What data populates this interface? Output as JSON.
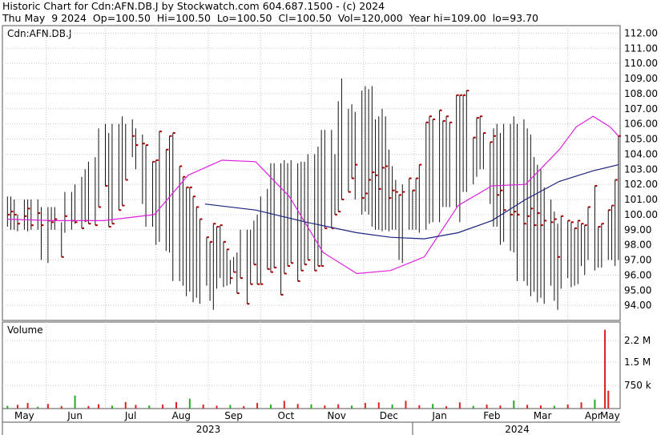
{
  "header": {
    "line1": "Historic Chart for Cdn:AFN.DB.J by Stockwatch.com 604.687.1500 - (c) 2024",
    "line2": "Thu May  9 2024  Op=100.50  Hi=100.50  Lo=100.50  Cl=100.50  Vol=120,000  Year hi=109.00  lo=93.70"
  },
  "chart_data": [
    {
      "type": "ohlc",
      "title": "Cdn:AFN.DB.J",
      "ylim": [
        93.0,
        112.5
      ],
      "yticks": [
        "112.00",
        "111.00",
        "110.00",
        "109.00",
        "108.00",
        "107.00",
        "106.00",
        "105.00",
        "104.00",
        "103.00",
        "102.00",
        "101.00",
        "100.00",
        "99.00",
        "98.00",
        "97.00",
        "96.00",
        "95.00",
        "94.00"
      ],
      "month_labels": [
        "May",
        "Jun",
        "Jul",
        "Aug",
        "Sep",
        "Oct",
        "Nov",
        "Dec",
        "Jan",
        "Feb",
        "Mar",
        "Apr",
        "May"
      ],
      "year_labels": [
        "2023",
        "2024"
      ],
      "colors": {
        "bar": "#aa0000",
        "ma_short": "#dd22dd",
        "ma_long": "#1a237e",
        "grid": "#c8c8c8"
      },
      "series": [
        {
          "days": [
            3,
            5,
            7,
            9,
            13,
            15,
            17,
            21,
            23,
            27,
            29,
            31,
            35,
            37,
            41,
            43,
            47,
            49,
            51,
            55,
            57,
            61,
            63,
            65,
            69,
            71,
            73,
            77,
            79,
            83,
            85,
            89,
            91,
            93,
            97,
            99,
            101,
            105,
            107,
            109,
            111,
            113,
            115,
            117,
            121,
            123,
            125,
            127,
            129,
            131,
            133,
            135,
            137,
            139,
            141,
            145,
            147,
            149,
            151,
            153,
            157,
            159,
            161,
            165,
            167,
            169,
            171,
            175,
            177,
            179,
            181,
            185,
            187,
            189,
            191,
            195,
            197,
            199,
            201,
            205,
            207,
            209,
            213,
            215,
            217,
            219,
            221,
            223,
            225,
            227,
            229,
            231,
            233,
            235,
            237,
            241,
            243,
            245,
            247,
            251,
            253,
            255,
            259,
            261,
            263,
            265,
            269,
            271,
            273,
            275,
            279,
            281,
            283,
            285,
            289,
            291,
            293,
            295,
            297,
            301,
            303,
            305,
            309,
            311,
            313,
            315,
            317,
            319,
            321,
            325,
            327,
            329,
            331,
            335,
            337,
            339,
            341,
            343,
            345,
            347,
            351,
            353,
            355,
            359,
            361,
            363,
            365
          ],
          "o": [
            100.0,
            100.2,
            100.0,
            99.4,
            99.9,
            100.4,
            99.3,
            100.1,
            99.3,
            99.6,
            99.5,
            99.7,
            97.2,
            99.9,
            99.6,
            99.5,
            99.1,
            99.6,
            99.4,
            99.3,
            100.5,
            101.9,
            99.2,
            99.4,
            100.3,
            100.6,
            102.3,
            105.2,
            104.6,
            104.7,
            104.6,
            103.5,
            103.6,
            105.5,
            104.3,
            105.2,
            105.4,
            103.2,
            102.5,
            101.8,
            101.8,
            101.2,
            100.5,
            99.7,
            98.5,
            98.2,
            99.4,
            99.2,
            99.3,
            98.2,
            97.7,
            95.8,
            96.2,
            94.8,
            95.8,
            94.1,
            95.4,
            96.7,
            95.4,
            95.4,
            96.4,
            96.2,
            96.5,
            94.7,
            96.1,
            96.6,
            96.8,
            95.6,
            96.3,
            96.7,
            97.0,
            96.3,
            96.6,
            96.6,
            99.1,
            99.1,
            100.0,
            100.2,
            101.0,
            101.5,
            102.4,
            103.3,
            101.1,
            101.4,
            102.3,
            102.8,
            102.6,
            101.7,
            103.1,
            103.2,
            101.1,
            101.6,
            101.5,
            101.3,
            101.5,
            102.4,
            101.6,
            102.4,
            103.3,
            106.1,
            106.5,
            106.3,
            106.9,
            106.2,
            106.5,
            106.1,
            107.9,
            107.9,
            107.9,
            108.2,
            105.1,
            106.4,
            106.5,
            105.4,
            104.8,
            105.2,
            101.3,
            101.6,
            100.3
          ],
          "h": [
            101.2,
            101.2,
            101.0,
            100.0,
            101.0,
            101.0,
            101.0,
            101.0,
            100.5,
            100.5,
            100.5,
            100.5,
            99.5,
            101.5,
            101.5,
            102.0,
            102.5,
            103.0,
            103.5,
            103.8,
            105.7,
            106.0,
            105.4,
            106.0,
            106.0,
            106.5,
            106.0,
            106.3,
            105.7,
            105.3,
            103.8,
            103.3,
            103.0,
            101.8,
            101.0,
            100.2,
            99.4,
            99.4,
            99.4,
            99.3,
            98.7,
            97.5,
            96.6,
            96.0,
            97.0,
            96.3,
            96.5,
            96.5,
            97.0,
            97.0,
            96.6,
            97.0,
            97.2,
            96.6,
            99.0,
            97.0,
            97.2,
            99.6,
            100.0,
            101.2,
            101.7,
            103.4,
            103.4,
            103.4,
            103.6,
            103.4,
            103.6,
            103.4,
            103.5,
            103.5,
            103.6,
            103.2,
            103.2,
            103.5,
            103.4,
            102.5,
            104.0,
            107.5,
            109.0,
            107.0,
            107.3,
            106.8,
            108.2,
            108.5,
            108.3,
            108.5,
            106.3,
            106.5,
            107.0,
            106.5,
            104.3,
            103.2,
            102.3,
            101.0,
            102.0
          ],
          "l": [
            99.2,
            99.0,
            99.0,
            98.9,
            99.0,
            98.9,
            99.0,
            99.0,
            97.0,
            96.8,
            99.0,
            99.0,
            99.0,
            98.8,
            99.0,
            99.4,
            99.5,
            99.5,
            101.5,
            101.5,
            103.3,
            104.0,
            104.2,
            102.5,
            103.0,
            103.5,
            104.5,
            103.8,
            103.0,
            100.7,
            99.2,
            99.2,
            98.0,
            98.2,
            97.6,
            97.5,
            95.6,
            95.6,
            95.3,
            94.6,
            94.9,
            94.2,
            94.5,
            94.1,
            95.3,
            94.3,
            93.7,
            95.1,
            95.8,
            95.2,
            95.3,
            95.4,
            96.6,
            97.5,
            98.9,
            99.0,
            99.0,
            99.3,
            100.0,
            100.4,
            101.6,
            101.6,
            101.0,
            101.2,
            101.0,
            101.0,
            101.0,
            101.4,
            101.2,
            102.0,
            104.0,
            104.0,
            104.5,
            105.6,
            105.6,
            105.6,
            104.0,
            104.6,
            105.0,
            104.6,
            104.0,
            101.0,
            100.0,
            100.2,
            100.0
          ]
        },
        {
          "ma_short_x": [
            3,
            30,
            60,
            90,
            110,
            130,
            150,
            170,
            190,
            210,
            230,
            250,
            270,
            290,
            310,
            330,
            340,
            350,
            360,
            365
          ],
          "ma_short_y": [
            99.7,
            99.6,
            99.6,
            100.0,
            102.6,
            103.6,
            103.5,
            101.2,
            97.5,
            96.1,
            96.3,
            97.2,
            100.6,
            101.9,
            102.0,
            104.3,
            105.8,
            106.5,
            105.8,
            105.2
          ],
          "ma_long_x": [
            120,
            150,
            180,
            210,
            230,
            250,
            270,
            290,
            310,
            330,
            350,
            365
          ],
          "ma_long_y": [
            100.7,
            100.3,
            99.5,
            98.8,
            98.5,
            98.4,
            98.8,
            99.6,
            101.0,
            102.2,
            102.9,
            103.3
          ]
        }
      ]
    },
    {
      "type": "bar",
      "title": "Volume",
      "yticks": [
        "2.2 M",
        "1.5 M",
        "750 k"
      ],
      "ytick_values": [
        2200000,
        1500000,
        750000
      ],
      "ylim": [
        0,
        2800000
      ],
      "values_x": [
        3,
        9,
        15,
        21,
        27,
        35,
        43,
        51,
        57,
        65,
        73,
        79,
        87,
        95,
        103,
        111,
        119,
        127,
        135,
        143,
        151,
        159,
        167,
        175,
        183,
        191,
        199,
        207,
        215,
        223,
        231,
        239,
        247,
        255,
        263,
        271,
        279,
        287,
        295,
        303,
        311,
        319,
        327,
        335,
        343,
        351,
        357,
        359
      ],
      "values": [
        90000,
        120000,
        180000,
        60000,
        150000,
        80000,
        420000,
        80000,
        140000,
        95000,
        210000,
        120000,
        100000,
        130000,
        210000,
        320000,
        130000,
        95000,
        120000,
        75000,
        180000,
        130000,
        250000,
        150000,
        130000,
        100000,
        140000,
        95000,
        180000,
        200000,
        130000,
        250000,
        110000,
        150000,
        75000,
        200000,
        90000,
        130000,
        100000,
        260000,
        120000,
        100000,
        90000,
        130000,
        200000,
        290000,
        2550000,
        580000
      ]
    }
  ]
}
